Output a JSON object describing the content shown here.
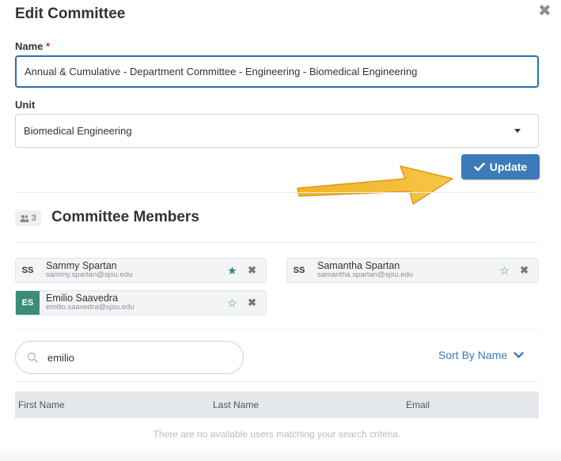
{
  "modal": {
    "title": "Edit Committee",
    "close_icon": "close-icon"
  },
  "form": {
    "name_label": "Name",
    "required_mark": "*",
    "name_value": "Annual & Cumulative - Department Committee - Engineering - Biomedical Engineering",
    "unit_label": "Unit",
    "unit_value": "Biomedical Engineering",
    "update_label": "Update"
  },
  "members": {
    "count": "3",
    "title": "Committee Members",
    "list": [
      {
        "initials": "SS",
        "name": "Sammy Spartan",
        "email": "sammy.spartan@sjsu.edu",
        "starred": true
      },
      {
        "initials": "SS",
        "name": "Samantha Spartan",
        "email": "samantha.spartan@sjsu.edu",
        "starred": false
      },
      {
        "initials": "ES",
        "name": "Emilio Saavedra",
        "email": "emilio.saavedra@sjsu.edu",
        "starred": false
      }
    ]
  },
  "search": {
    "value": "emilio",
    "sort_label": "Sort By Name"
  },
  "table": {
    "headers": [
      "First Name",
      "Last Name",
      "Email"
    ],
    "empty_message": "There are no available users matching your search criteria."
  },
  "colors": {
    "accent": "#3d7ab8",
    "teal": "#3c8c7a",
    "arrow": "#f2b731"
  }
}
